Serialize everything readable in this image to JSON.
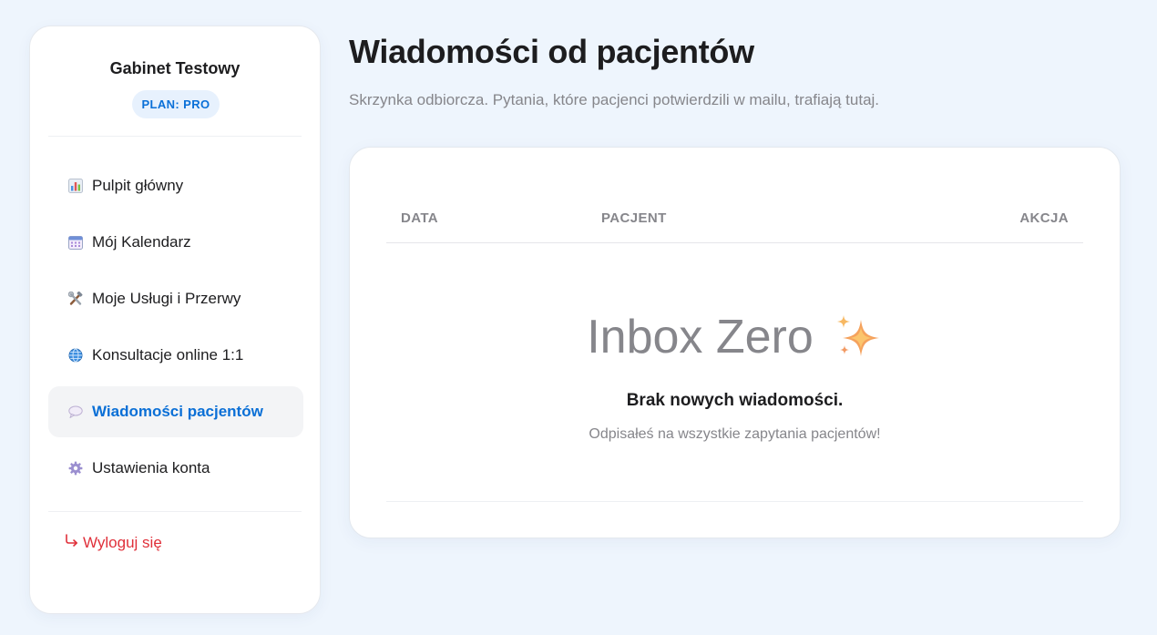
{
  "sidebar": {
    "brand": "Gabinet Testowy",
    "plan_badge": "PLAN: PRO",
    "items": [
      {
        "label": "Pulpit główny",
        "icon": "bar-chart-icon"
      },
      {
        "label": "Mój Kalendarz",
        "icon": "calendar-icon"
      },
      {
        "label": "Moje Usługi i Przerwy",
        "icon": "tools-icon"
      },
      {
        "label": "Konsultacje online 1:1",
        "icon": "globe-icon"
      },
      {
        "label": "Wiadomości pacjentów",
        "icon": "speech-bubble-icon",
        "active": true
      },
      {
        "label": "Ustawienia konta",
        "icon": "gear-icon"
      }
    ],
    "logout": {
      "label": "Wyloguj się",
      "icon": "logout-arrow-icon"
    }
  },
  "main": {
    "title": "Wiadomości od pacjentów",
    "subtitle": "Skrzynka odbiorcza. Pytania, które pacjenci potwierdzili w mailu, trafiają tutaj.",
    "table": {
      "columns": [
        "DATA",
        "PACJENT",
        "AKCJA"
      ]
    },
    "empty_state": {
      "title": "Inbox Zero",
      "icon": "sparkles-icon",
      "heading": "Brak nowych wiadomości.",
      "text": "Odpisałeś na wszystkie zapytania pacjentów!"
    }
  },
  "colors": {
    "background": "#eef5fd",
    "accent": "#0a6fd6",
    "danger": "#e0303a",
    "muted": "#86868b",
    "badge_bg": "#e7f1fd"
  }
}
